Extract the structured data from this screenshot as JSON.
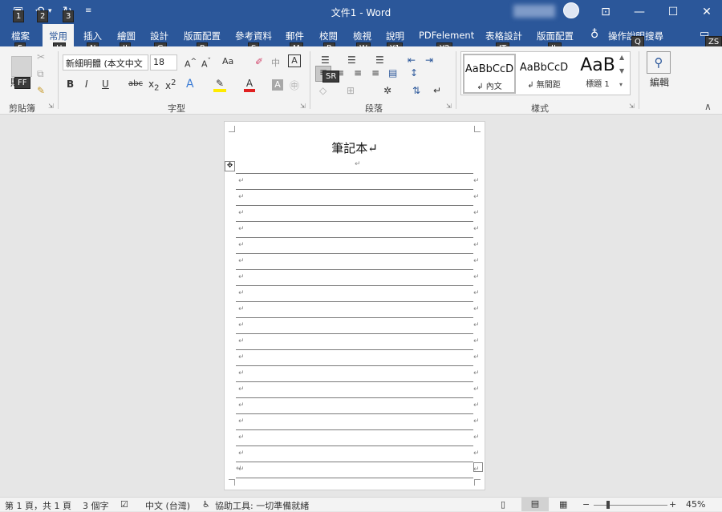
{
  "window": {
    "title": "文件1 - Word"
  },
  "qat_keytips": [
    "1",
    "2",
    "3"
  ],
  "tabs": [
    {
      "label": "檔案",
      "keytip": "F"
    },
    {
      "label": "常用",
      "keytip": "H"
    },
    {
      "label": "插入",
      "keytip": "N"
    },
    {
      "label": "繪圖",
      "keytip": "JI"
    },
    {
      "label": "設計",
      "keytip": "G"
    },
    {
      "label": "版面配置",
      "keytip": "P"
    },
    {
      "label": "參考資料",
      "keytip": "S"
    },
    {
      "label": "郵件",
      "keytip": "M"
    },
    {
      "label": "校閱",
      "keytip": "R"
    },
    {
      "label": "檢視",
      "keytip": "W"
    },
    {
      "label": "說明",
      "keytip": "Y1"
    },
    {
      "label": "PDFelement",
      "keytip": "Y2"
    },
    {
      "label": "表格設計",
      "keytip": "JT"
    },
    {
      "label": "版面配置",
      "keytip": "JL"
    }
  ],
  "search": {
    "label": "操作說明搜尋",
    "keytip": "Q"
  },
  "share_keytip": "ZS",
  "ribbon": {
    "clipboard": {
      "paste_label": "貼上",
      "group_label": "剪貼簿"
    },
    "font": {
      "name": "新細明體 (本文中文",
      "size": "18",
      "group_label": "字型",
      "case_label": "Aa"
    },
    "paragraph": {
      "group_label": "段落"
    },
    "styles": {
      "group_label": "樣式",
      "items": [
        {
          "preview": "AaBbCcD",
          "name": "↲ 內文"
        },
        {
          "preview": "AaBbCcD",
          "name": "↲ 無間距"
        },
        {
          "preview": "AaB",
          "name": "標題 1"
        }
      ]
    },
    "editing": {
      "label": "編輯"
    }
  },
  "document": {
    "title": "筆記本↵",
    "line_count": 19,
    "para_mark": "↵"
  },
  "statusbar": {
    "page": "第 1 頁，共 1 頁",
    "words": "3 個字",
    "language": "中文 (台灣)",
    "accessibility": "協助工具: 一切準備就緒",
    "zoom": "45%"
  }
}
